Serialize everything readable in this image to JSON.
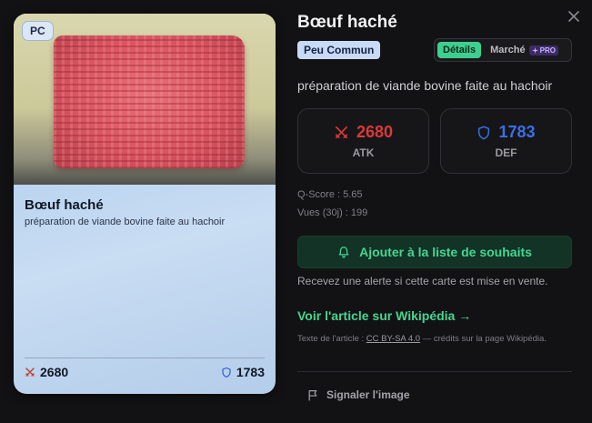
{
  "card": {
    "platform_badge": "PC",
    "title": "Bœuf haché",
    "description": "préparation de viande bovine faite au hachoir",
    "atk": "2680",
    "def": "1783"
  },
  "panel": {
    "title": "Bœuf haché",
    "rarity": "Peu Commun",
    "toggle": {
      "details_label": "Détails",
      "market_label": "Marché",
      "pro_label": "PRO",
      "active": "Détails"
    },
    "description": "préparation de viande bovine faite au hachoir",
    "stats": {
      "atk_value": "2680",
      "atk_label": "ATK",
      "def_value": "1783",
      "def_label": "DEF"
    },
    "q_score": "Q-Score : 5.65",
    "views": "Vues (30j) : 199",
    "wishlist_button": "Ajouter à la liste de souhaits",
    "wishlist_help": "Recevez une alerte si cette carte est mise en vente.",
    "wiki_link": "Voir l'article sur Wikipédia →",
    "license_prefix": "Texte de l'article : ",
    "license_name": "CC BY-SA 4.0",
    "license_suffix": " — crédits sur la page Wikipédia.",
    "report_label": "Signaler l'image"
  },
  "colors": {
    "accent_green": "#45d691",
    "atk_red": "#d83a3a",
    "def_blue": "#3b6fe8",
    "rarity_bg": "#c8daf5"
  },
  "icons": [
    "close-icon",
    "swords-icon",
    "shield-icon",
    "bell-icon",
    "sparkle-icon",
    "flag-icon"
  ]
}
